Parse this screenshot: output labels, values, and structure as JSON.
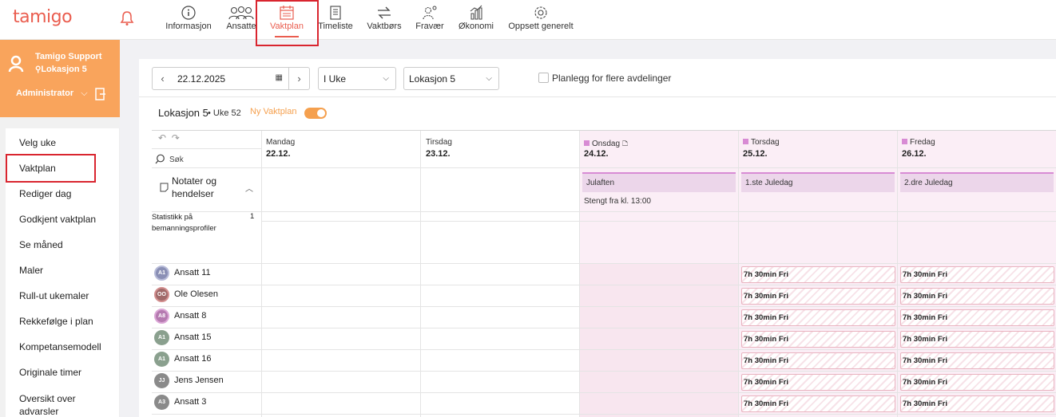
{
  "app": {
    "logo": "tamigo"
  },
  "topnav": {
    "items": [
      {
        "label": "Informasjon",
        "icon": "info-icon"
      },
      {
        "label": "Ansatte",
        "icon": "people-icon"
      },
      {
        "label": "Vaktplan",
        "icon": "calendar-icon",
        "active": true
      },
      {
        "label": "Timeliste",
        "icon": "timesheet-icon"
      },
      {
        "label": "Vaktbørs",
        "icon": "exchange-icon"
      },
      {
        "label": "Fravær",
        "icon": "absence-icon"
      },
      {
        "label": "Økonomi",
        "icon": "economy-icon"
      },
      {
        "label": "Oppsett generelt",
        "icon": "gear-icon"
      }
    ]
  },
  "user": {
    "name": "Tamigo Support",
    "location": "Lokasjon 5",
    "role": "Administrator"
  },
  "sidebar": {
    "items": [
      {
        "label": "Velg uke"
      },
      {
        "label": "Vaktplan",
        "active": true
      },
      {
        "label": "Rediger dag"
      },
      {
        "label": "Godkjent vaktplan"
      },
      {
        "label": "Se måned"
      },
      {
        "label": "Maler"
      },
      {
        "label": "Rull-ut ukemaler"
      },
      {
        "label": "Rekkefølge i plan"
      },
      {
        "label": "Kompetansemodell"
      },
      {
        "label": "Originale timer"
      },
      {
        "label": "Oversikt over advarsler"
      }
    ]
  },
  "filters": {
    "date": "22.12.2025",
    "period": "I Uke",
    "location": "Lokasjon 5",
    "multi_dept_label": "Planlegg for flere avdelinger"
  },
  "plan": {
    "title": "Lokasjon 5",
    "week": "• Uke 52",
    "new_label": "Ny Vaktplan",
    "toggle_on": true,
    "search_label": "Søk",
    "notes_label": "Notater og hendelser",
    "stats_label": "Statistikk på bemanningsprofiler",
    "stats_count": "1"
  },
  "days": [
    {
      "name": "Mandag",
      "date": "22.12.",
      "holiday": false
    },
    {
      "name": "Tirsdag",
      "date": "23.12.",
      "holiday": false
    },
    {
      "name": "Onsdag",
      "date": "24.12.",
      "holiday": true,
      "event": "Julaften",
      "note": "Stengt fra kl. 13:00"
    },
    {
      "name": "Torsdag",
      "date": "25.12.",
      "holiday": true,
      "event": "1.ste Juledag"
    },
    {
      "name": "Fredag",
      "date": "26.12.",
      "holiday": true,
      "event": "2.dre Juledag"
    }
  ],
  "employees": [
    {
      "initials": "A1",
      "name": "Ansatt 11",
      "avatar_color": "#8a8fb5"
    },
    {
      "initials": "OO",
      "name": "Ole Olesen",
      "avatar_color": "#a06a6a"
    },
    {
      "initials": "A8",
      "name": "Ansatt 8",
      "avatar_color": "#b57ab0"
    },
    {
      "initials": "A1",
      "name": "Ansatt 15",
      "avatar_color": "#8aa08e"
    },
    {
      "initials": "A1",
      "name": "Ansatt 16",
      "avatar_color": "#8aa08e"
    },
    {
      "initials": "JJ",
      "name": "Jens Jensen",
      "avatar_color": "#8a8a8a"
    },
    {
      "initials": "A3",
      "name": "Ansatt 3",
      "avatar_color": "#8a8a8a"
    }
  ],
  "shift_label": "7h 30min Fri",
  "colors": {
    "accent": "#ea5d4f",
    "orange": "#f9a45c",
    "holiday_bg": "#fbeef6",
    "highlight": "#d9252f"
  }
}
